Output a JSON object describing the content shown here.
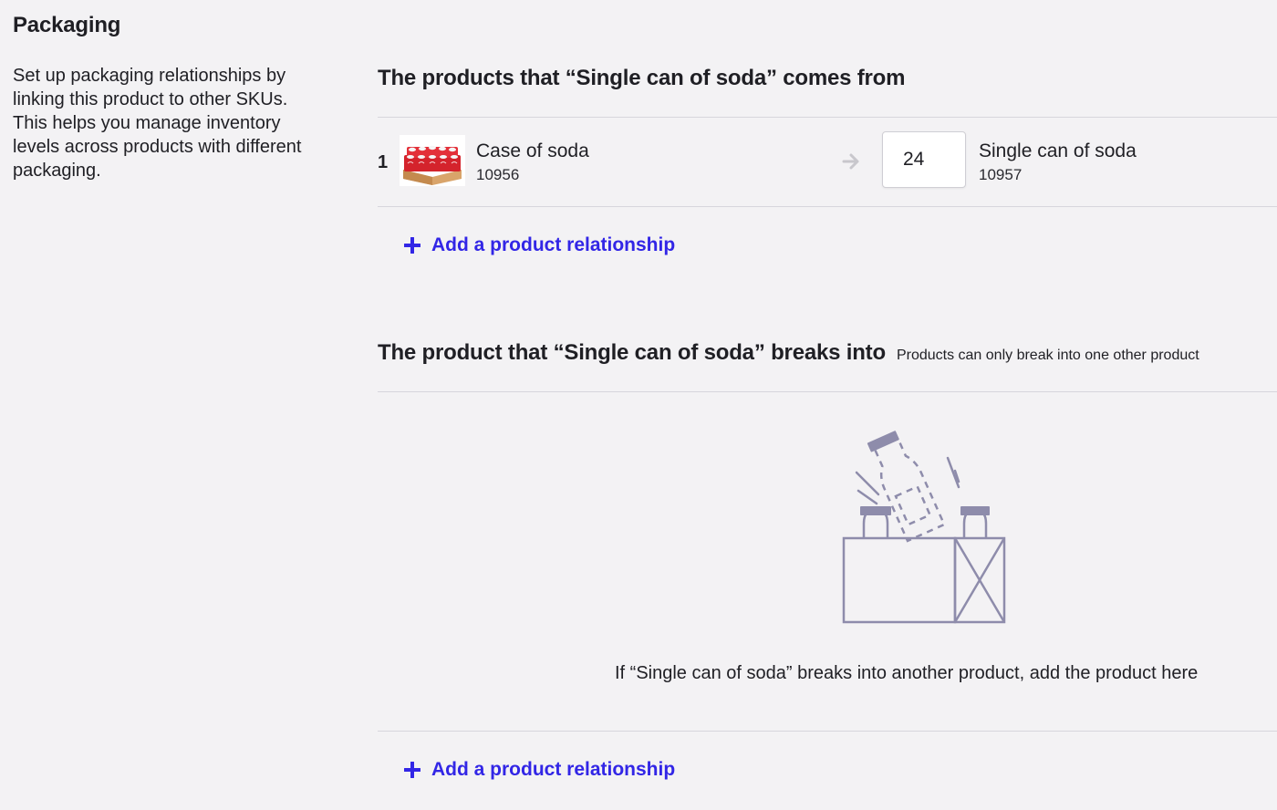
{
  "page": {
    "title": "Packaging",
    "description": "Set up packaging relationships by linking this product to other SKUs. This helps you manage inventory levels across products with different packaging."
  },
  "comes_from": {
    "title": "The products that “Single can of soda” comes from",
    "rows": [
      {
        "index": "1",
        "image": "case-of-soda-thumbnail",
        "from_name": "Case of soda",
        "from_sku": "10956",
        "quantity": "24",
        "to_name": "Single can of soda",
        "to_sku": "10957"
      }
    ],
    "add_label": "Add a product relationship"
  },
  "breaks_into": {
    "title": "The product that “Single can of soda” breaks into",
    "note": "Products can only break into one other product",
    "empty_text": "If “Single can of soda” breaks into another product, add the product here",
    "add_label": "Add a product relationship"
  },
  "icons": {
    "add": "plus-icon",
    "arrow": "arrow-right-icon",
    "empty_state": "bottles-in-crate-illustration"
  },
  "colors": {
    "background": "#f3f2f4",
    "accent": "#3226e6",
    "divider": "#d7d6dc",
    "illustration": "#8e8cab",
    "arrow": "#c8c7cc"
  }
}
